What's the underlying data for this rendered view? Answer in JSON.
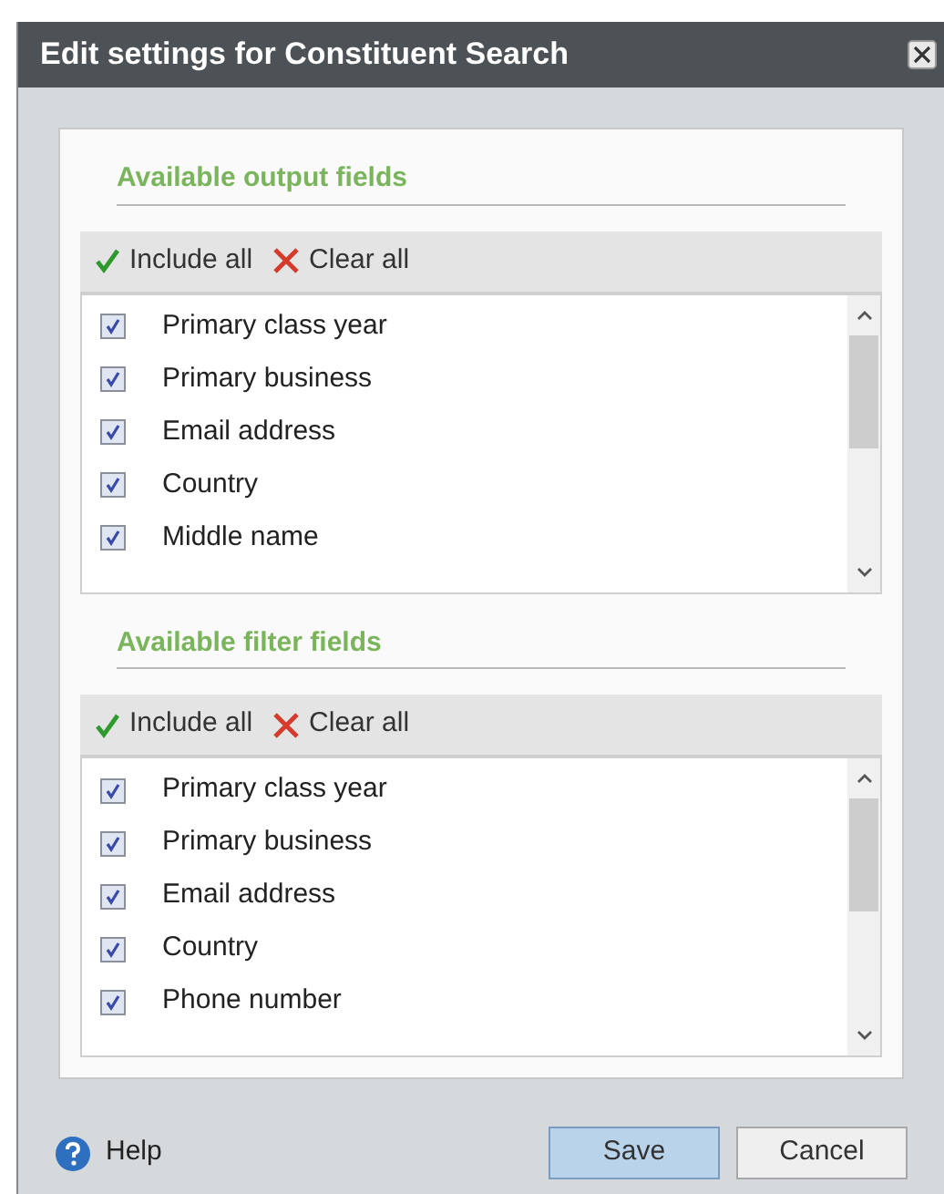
{
  "window": {
    "title": "Edit settings for Constituent Search"
  },
  "sections": [
    {
      "title": "Available output fields",
      "toolbar": [
        "Include all",
        "Clear all"
      ],
      "items": [
        {
          "label": "Primary class year",
          "checked": true
        },
        {
          "label": "Primary business",
          "checked": true
        },
        {
          "label": "Email address",
          "checked": true
        },
        {
          "label": "Country",
          "checked": true
        },
        {
          "label": "Middle name",
          "checked": true
        }
      ]
    },
    {
      "title": "Available filter fields",
      "toolbar": [
        "Include all",
        "Clear all"
      ],
      "items": [
        {
          "label": "Primary class year",
          "checked": true
        },
        {
          "label": "Primary business",
          "checked": true
        },
        {
          "label": "Email address",
          "checked": true
        },
        {
          "label": "Country",
          "checked": true
        },
        {
          "label": "Phone number",
          "checked": true
        }
      ]
    }
  ],
  "footer": {
    "help": "Help",
    "buttons": [
      {
        "label": "Save",
        "primary": true
      },
      {
        "label": "Cancel",
        "primary": false
      }
    ]
  }
}
